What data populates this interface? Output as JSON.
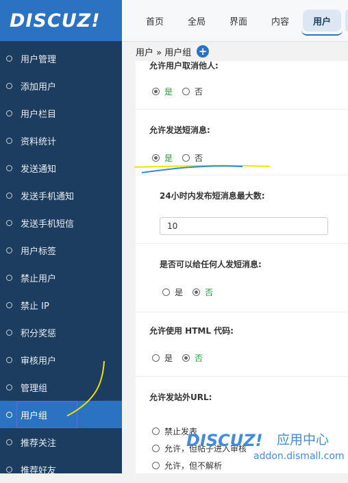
{
  "app": {
    "logo_text": "DISCUZ!"
  },
  "sidebar": {
    "items": [
      {
        "label": "用户管理"
      },
      {
        "label": "添加用户"
      },
      {
        "label": "用户栏目"
      },
      {
        "label": "资料统计"
      },
      {
        "label": "发送通知"
      },
      {
        "label": "发送手机通知"
      },
      {
        "label": "发送手机短信"
      },
      {
        "label": "用户标签"
      },
      {
        "label": "禁止用户"
      },
      {
        "label": "禁止 IP"
      },
      {
        "label": "积分奖惩"
      },
      {
        "label": "审核用户"
      },
      {
        "label": "管理组"
      },
      {
        "label": "用户组"
      },
      {
        "label": "推荐关注"
      },
      {
        "label": "推荐好友"
      }
    ],
    "active_item": "用户组"
  },
  "topnav": {
    "tabs": [
      {
        "label": "首页"
      },
      {
        "label": "全局"
      },
      {
        "label": "界面"
      },
      {
        "label": "内容"
      },
      {
        "label": "用户"
      }
    ],
    "active_tab": "用户"
  },
  "breadcrumb": {
    "text": "用户 » 用户组"
  },
  "form": {
    "section1": {
      "label": "允许用户取消他人:",
      "options": [
        "是",
        "否"
      ],
      "selected": "是"
    },
    "section2": {
      "label": "允许发送短消息:",
      "options": [
        "是",
        "否"
      ],
      "selected": "是"
    },
    "section3": {
      "label": "24小时内发布短消息最大数:",
      "value": "10"
    },
    "section4": {
      "label": "是否可以给任何人发短消息:",
      "options": [
        "是",
        "否"
      ],
      "selected": "否"
    },
    "section5": {
      "label": "允许使用 HTML 代码:",
      "options": [
        "是",
        "否"
      ],
      "selected": "否"
    },
    "section6": {
      "label": "允许发站外URL:",
      "options": [
        "禁止发表",
        "允许，但帖子进入审核",
        "允许，但不解析"
      ]
    }
  },
  "watermark": {
    "brand": "DISCUZ!",
    "title_cn": "应用中心",
    "url": "addon.dismall.com"
  },
  "colors": {
    "sidebar_bg": "#1c3d5f",
    "accent": "#2b72c2",
    "selected_option": "#2b9a3a",
    "annotation_yellow": "#f5e000",
    "annotation_blue": "#2b8ad6"
  }
}
